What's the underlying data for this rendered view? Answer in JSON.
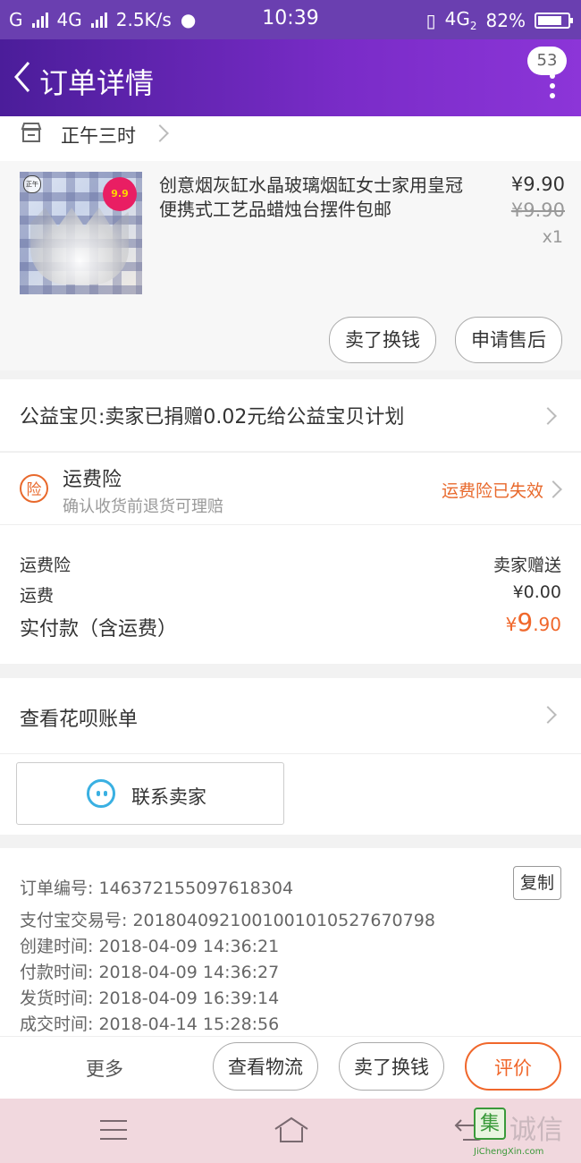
{
  "status_bar": {
    "carrier": "G",
    "network": "4G",
    "speed": "2.5K/s",
    "time": "10:39",
    "network2": "4G",
    "network2_sub": "2",
    "battery": "82%",
    "battery_level": 0.82
  },
  "navbar": {
    "title": "订单详情",
    "badge_count": "53"
  },
  "shop": {
    "name": "正午三时"
  },
  "item": {
    "title": "创意烟灰缸水晶玻璃烟缸女士家用皇冠便携式工艺品蜡烛台摆件包邮",
    "price": "¥9.90",
    "original_price": "¥9.90",
    "quantity": "x1",
    "image_tag": "9.9",
    "sell_button": "卖了换钱",
    "after_sale_button": "申请售后"
  },
  "charity": {
    "text": "公益宝贝:卖家已捐赠0.02元给公益宝贝计划"
  },
  "insurance": {
    "icon_label": "险",
    "title": "运费险",
    "subtitle": "确认收货前退货可理赔",
    "status": "运费险已失效"
  },
  "fees": [
    {
      "label": "运费险",
      "value": "卖家赠送"
    },
    {
      "label": "运费",
      "value": "¥0.00"
    }
  ],
  "total": {
    "label": "实付款（含运费）",
    "currency": "¥",
    "integer": "9",
    "decimal": ".90"
  },
  "huabei": {
    "label": "查看花呗账单"
  },
  "contact": {
    "label": "联系卖家"
  },
  "order_info": {
    "copy_button": "复制",
    "lines": [
      "订单编号: 146372155097618304",
      "支付宝交易号: 2018040921001001010527670798",
      "创建时间: 2018-04-09 14:36:21",
      "付款时间: 2018-04-09 14:36:27",
      "发货时间: 2018-04-09 16:39:14",
      "成交时间: 2018-04-14 15:28:56"
    ]
  },
  "bottom_actions": {
    "more": "更多",
    "logistics": "查看物流",
    "sell": "卖了换钱",
    "review": "评价"
  },
  "watermark": {
    "mark": "集",
    "text": "诚信",
    "url": "JiChengXin.com"
  },
  "colors": {
    "accent": "#f0672b",
    "nav_gradient_start": "#4b1d9a",
    "nav_gradient_end": "#8c35d8",
    "contact_icon": "#3ab0e2"
  }
}
